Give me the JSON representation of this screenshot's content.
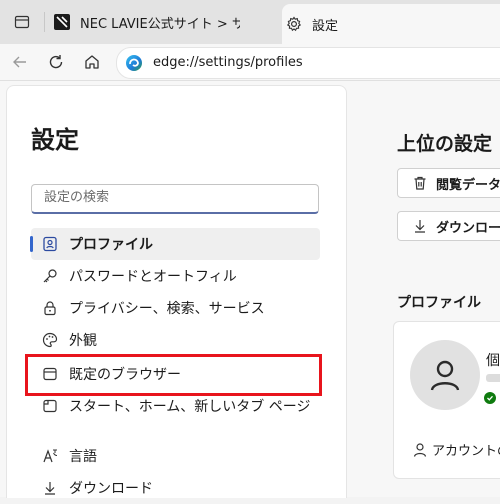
{
  "browser": {
    "tabs": [
      {
        "title": "NEC LAVIE公式サイト > サービス&サポート",
        "icon": "nec-favicon"
      },
      {
        "title": "設定",
        "icon": "gear-icon"
      }
    ],
    "url": "edge://settings/profiles"
  },
  "sidebar": {
    "title": "設定",
    "search_placeholder": "設定の検索",
    "items": [
      {
        "label": "プロファイル",
        "icon": "profile-card-icon"
      },
      {
        "label": "パスワードとオートフィル",
        "icon": "key-icon"
      },
      {
        "label": "プライバシー、検索、サービス",
        "icon": "lock-icon"
      },
      {
        "label": "外観",
        "icon": "palette-icon"
      },
      {
        "label": "既定のブラウザー",
        "icon": "browser-window-icon"
      },
      {
        "label": "スタート、ホーム、新しいタブ ページ",
        "icon": "start-page-icon"
      },
      {
        "label": "言語",
        "icon": "language-icon"
      },
      {
        "label": "ダウンロード",
        "icon": "download-icon"
      }
    ]
  },
  "main": {
    "title": "上位の設定",
    "buttons": [
      {
        "label": "閲覧データのクリア",
        "icon": "trash-icon"
      },
      {
        "label": "ダウンロード",
        "icon": "download-icon"
      }
    ],
    "profile_section_label": "プロファイル",
    "profile_name": "個人",
    "account_link": "アカウントの管理"
  },
  "colors": {
    "accent": "#3366cc",
    "highlight": "#e8141c",
    "sync": "#0f7b0f"
  }
}
